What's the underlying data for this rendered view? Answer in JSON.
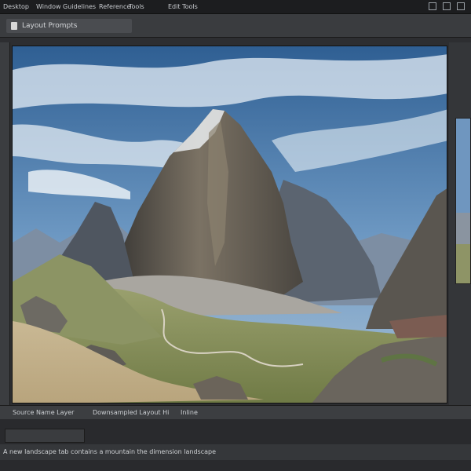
{
  "menubar": {
    "items": [
      {
        "label": "Desktop"
      },
      {
        "label": "Window"
      },
      {
        "label": "Guidelines"
      },
      {
        "label": "Reference"
      },
      {
        "label": "Tools"
      },
      {
        "label": "Edit Tools"
      }
    ]
  },
  "toolbar": {
    "document_title": "Layout Prompts"
  },
  "status_strip": {
    "left_text": "Source Name Layer",
    "middle_text": "Downsampled Layout Hi",
    "right_text": "Inline"
  },
  "caption_bar": {
    "text": "A new landscape tab contains a mountain the dimension landscape"
  },
  "icons": {
    "document": "document-icon",
    "window_controls": [
      "minimize-icon",
      "maximize-icon",
      "close-icon"
    ]
  },
  "colors": {
    "menubar_bg": "#1c1d1f",
    "toolbar_bg": "#3a3c3f",
    "workspace_bg": "#2d2e31",
    "sky": "#4f83b7"
  }
}
